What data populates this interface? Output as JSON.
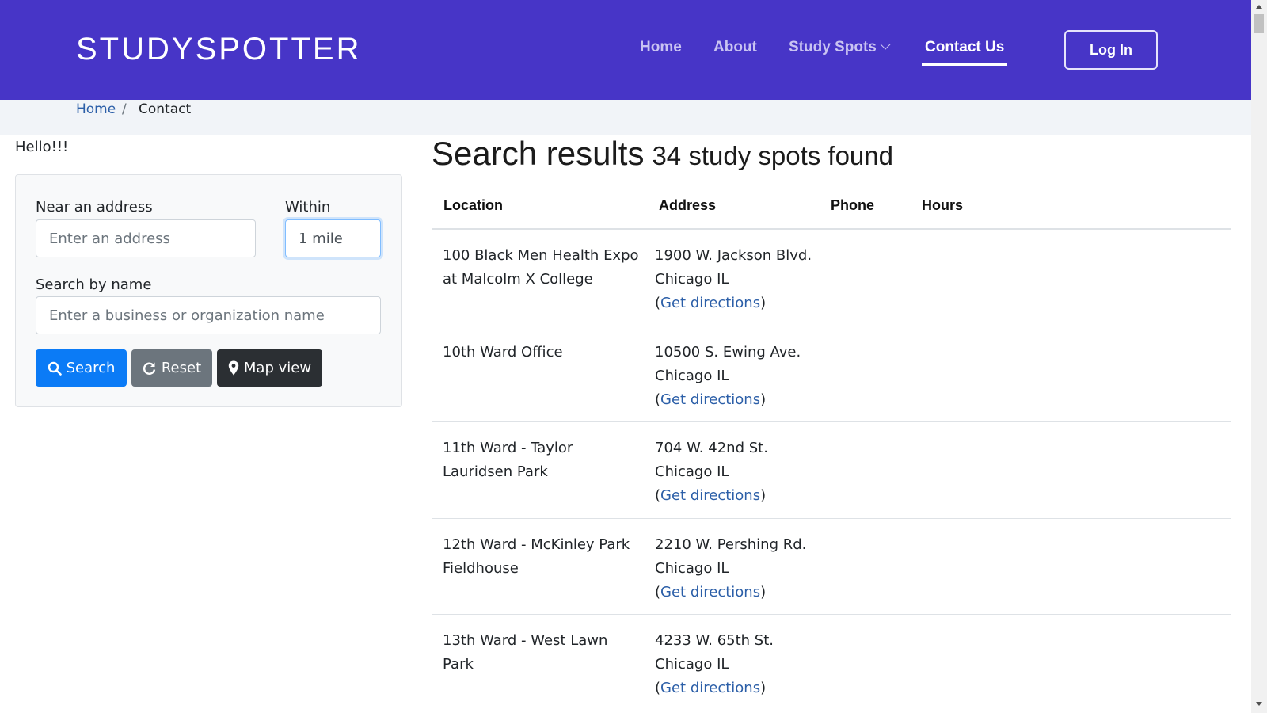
{
  "header": {
    "brand": "STUDYSPOTTER",
    "nav": {
      "home": "Home",
      "about": "About",
      "study_spots": "Study Spots",
      "contact": "Contact Us"
    },
    "login": "Log In",
    "accent": "#4735c7"
  },
  "breadcrumb": {
    "home": "Home",
    "separator": "/",
    "current": "Contact"
  },
  "greeting": "Hello!!!",
  "search": {
    "address_label": "Near an address",
    "address_placeholder": "Enter an address",
    "within_label": "Within",
    "within_value": "1 mile",
    "name_label": "Search by name",
    "name_placeholder": "Enter a business or organization name",
    "search_button": "Search",
    "reset_button": "Reset",
    "map_button": "Map view"
  },
  "results": {
    "title": "Search results",
    "count_text": "34 study spots found",
    "columns": {
      "location": "Location",
      "address": "Address",
      "phone": "Phone",
      "hours": "Hours"
    },
    "rows": [
      {
        "location": "100 Black Men Health Expo at Malcolm X College",
        "address": "1900 W. Jackson Blvd. Chicago IL",
        "directions": "Get directions"
      },
      {
        "location": "10th Ward Office",
        "address": "10500 S. Ewing Ave. Chicago IL",
        "directions": "Get directions"
      },
      {
        "location": "11th Ward - Taylor Lauridsen Park",
        "address": "704 W. 42nd St. Chicago IL",
        "directions": "Get directions"
      },
      {
        "location": "12th Ward - McKinley Park Fieldhouse",
        "address": "2210 W. Pershing Rd. Chicago IL",
        "directions": "Get directions"
      },
      {
        "location": "13th Ward - West Lawn Park",
        "address": "4233 W. 65th St. Chicago IL",
        "directions": "Get directions"
      }
    ]
  }
}
